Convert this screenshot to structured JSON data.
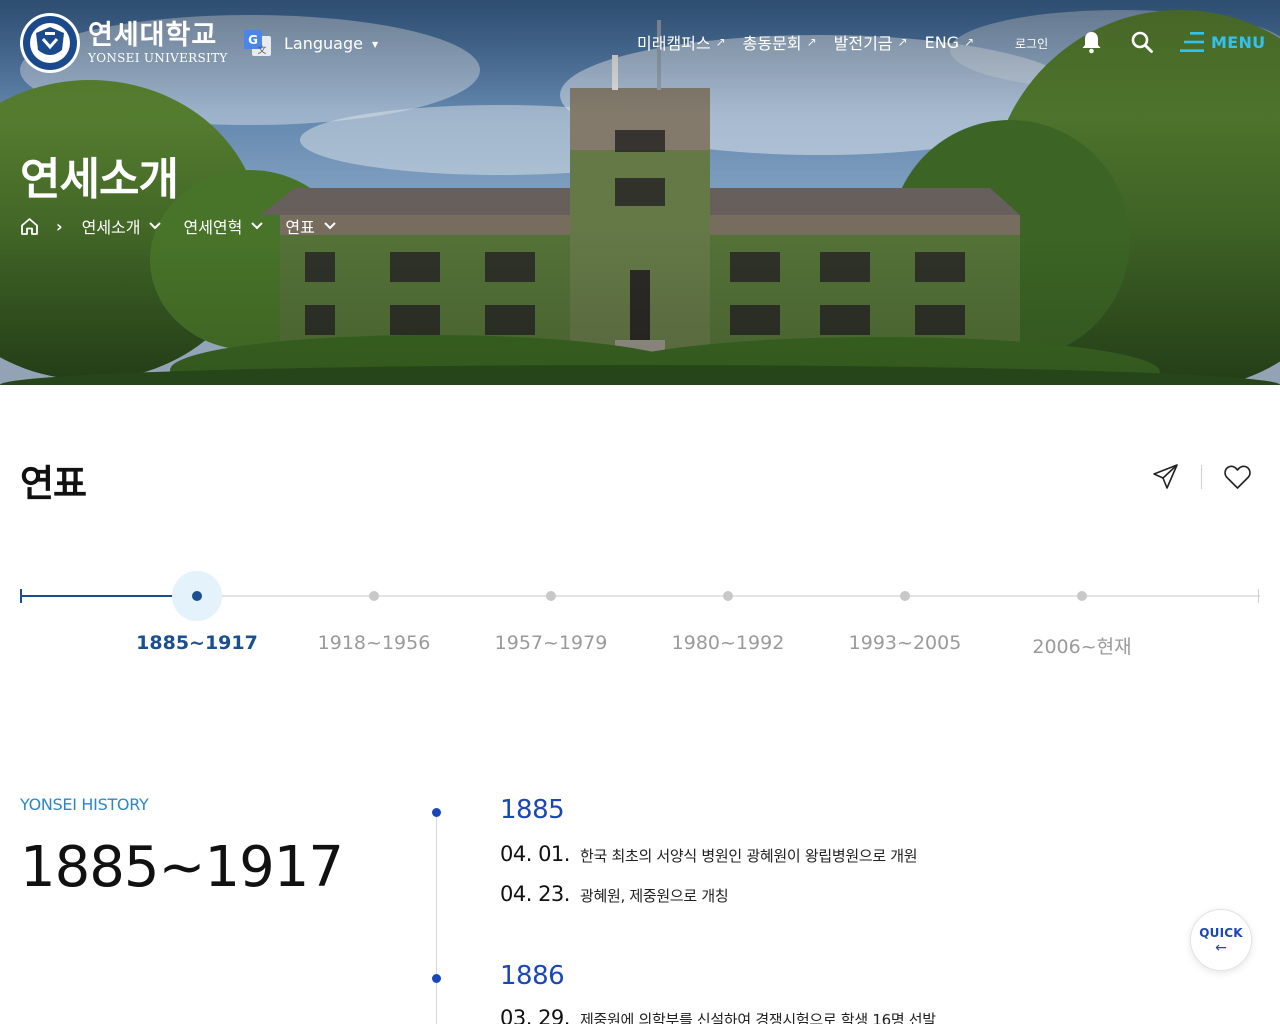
{
  "header": {
    "logo": {
      "name_ko": "연세대학교",
      "name_en": "YONSEI UNIVERSITY"
    },
    "language": {
      "label": "Language"
    },
    "nav": [
      {
        "label": "미래캠퍼스"
      },
      {
        "label": "총동문회"
      },
      {
        "label": "발전기금"
      },
      {
        "label": "ENG"
      }
    ],
    "login_label": "로그인",
    "menu_label": "MENU",
    "icons": [
      "google-translate-icon",
      "bell-icon",
      "search-icon",
      "hamburger-menu-icon"
    ]
  },
  "hero": {
    "title": "연세소개",
    "breadcrumb": [
      "연세소개",
      "연세연혁",
      "연표"
    ]
  },
  "page": {
    "title": "연표",
    "actions": [
      "share-icon",
      "heart-icon"
    ]
  },
  "timeline": {
    "periods": [
      "1885~1917",
      "1918~1956",
      "1957~1979",
      "1980~1992",
      "1993~2005",
      "2006~현재"
    ],
    "active": "1885~1917"
  },
  "history": {
    "tag": "YONSEI HISTORY",
    "range": "1885~1917",
    "years": [
      {
        "year": "1885",
        "events": [
          {
            "date": "04. 01.",
            "text": "한국 최초의 서양식 병원인 광혜원이 왕립병원으로 개원"
          },
          {
            "date": "04. 23.",
            "text": "광혜원, 제중원으로 개칭"
          }
        ]
      },
      {
        "year": "1886",
        "events": [
          {
            "date": "03. 29.",
            "text": "제중원에 의학부를 신설하여 경쟁시험으로 학생 16명 선발"
          }
        ]
      }
    ]
  },
  "quick": {
    "label": "QUICK",
    "arrow": "←"
  },
  "colors": {
    "primary": "#1a47b8",
    "timeline_active": "#1b4f8f",
    "menu_accent": "#33c2f0",
    "tag": "#2d86c8"
  }
}
